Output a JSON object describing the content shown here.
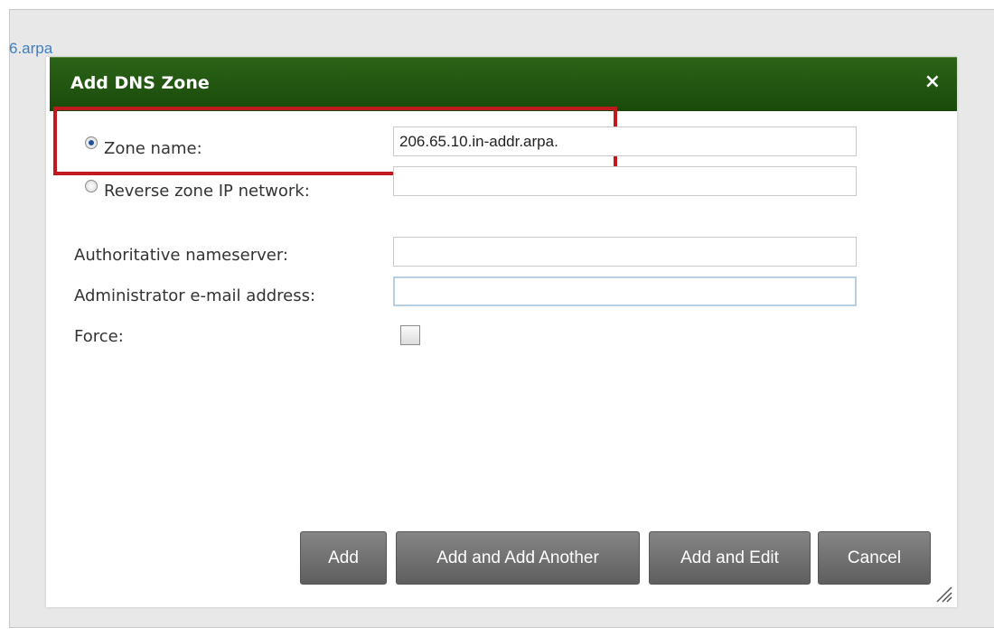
{
  "background": {
    "link_text": "6.arpa"
  },
  "dialog": {
    "title": "Add DNS Zone",
    "close_icon": "×",
    "zone_name": {
      "label": "Zone name:",
      "value": "206.65.10.in-addr.arpa.",
      "selected": true
    },
    "reverse_zone": {
      "label": "Reverse zone IP network:",
      "value": "",
      "selected": false
    },
    "authoritative_nameserver": {
      "label": "Authoritative nameserver:",
      "value": ""
    },
    "admin_email": {
      "label": "Administrator e-mail address:",
      "value": ""
    },
    "force": {
      "label": "Force:",
      "checked": false
    },
    "buttons": {
      "add": "Add",
      "add_another": "Add and Add Another",
      "add_edit": "Add and Edit",
      "cancel": "Cancel"
    }
  },
  "colors": {
    "titlebar": "#1f5410",
    "highlight": "#c0191e",
    "button": "#707070"
  }
}
